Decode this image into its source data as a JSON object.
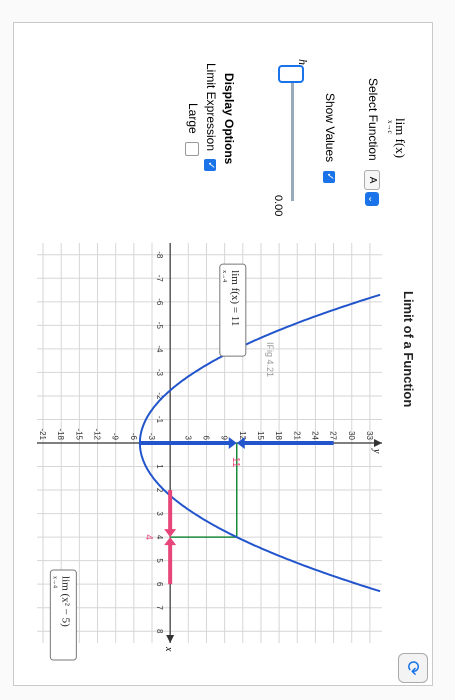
{
  "panel": {
    "limit_title": "lim f(x)",
    "limit_sub": "x→c",
    "select_label": "Select Function",
    "select_value": "A",
    "show_values_label": "Show Values",
    "h_label": "h",
    "slider_value": "0.00",
    "display_options_title": "Display Options",
    "limit_expression_label": "Limit Expression",
    "large_label": "Large",
    "fig_label": "IFig 4.21"
  },
  "header": {
    "title": "Limit of a Function",
    "refresh_icon": "refresh-icon"
  },
  "colors": {
    "accent": "#1a73e8",
    "curve": "#2255cc",
    "limit_marker": "#e8457a",
    "guide": "#1a8a3a"
  },
  "annotations": {
    "left_box": "lim f(x) = 11",
    "left_box_sub": "x→4",
    "right_box": "lim (x² − 5)",
    "right_box_sub": "x→4",
    "marker_x": "4",
    "marker_y": "11"
  },
  "chart_data": {
    "type": "line",
    "function": "x^2 - 5",
    "xlabel": "x",
    "ylabel": "y",
    "x_ticks": [
      -8,
      -7,
      -6,
      -5,
      -4,
      -3,
      -2,
      -1,
      1,
      2,
      3,
      4,
      5,
      6,
      7,
      8
    ],
    "y_ticks": [
      -21,
      -18,
      -15,
      -12,
      -9,
      -6,
      -3,
      3,
      6,
      9,
      12,
      15,
      18,
      21,
      24,
      27,
      30,
      33
    ],
    "xlim": [
      -8.5,
      8.5
    ],
    "ylim": [
      -22,
      35
    ],
    "grid": true,
    "limit_point": {
      "x": 4,
      "y": 11
    },
    "series": [
      {
        "x": [
          -6.325,
          -6,
          -5,
          -4,
          -3,
          -2,
          -1,
          0,
          1,
          2,
          3,
          4,
          5,
          6,
          6.325
        ],
        "values": [
          35,
          31,
          20,
          11,
          4,
          -1,
          -4,
          -5,
          -4,
          -1,
          4,
          11,
          20,
          31,
          35
        ]
      }
    ]
  }
}
